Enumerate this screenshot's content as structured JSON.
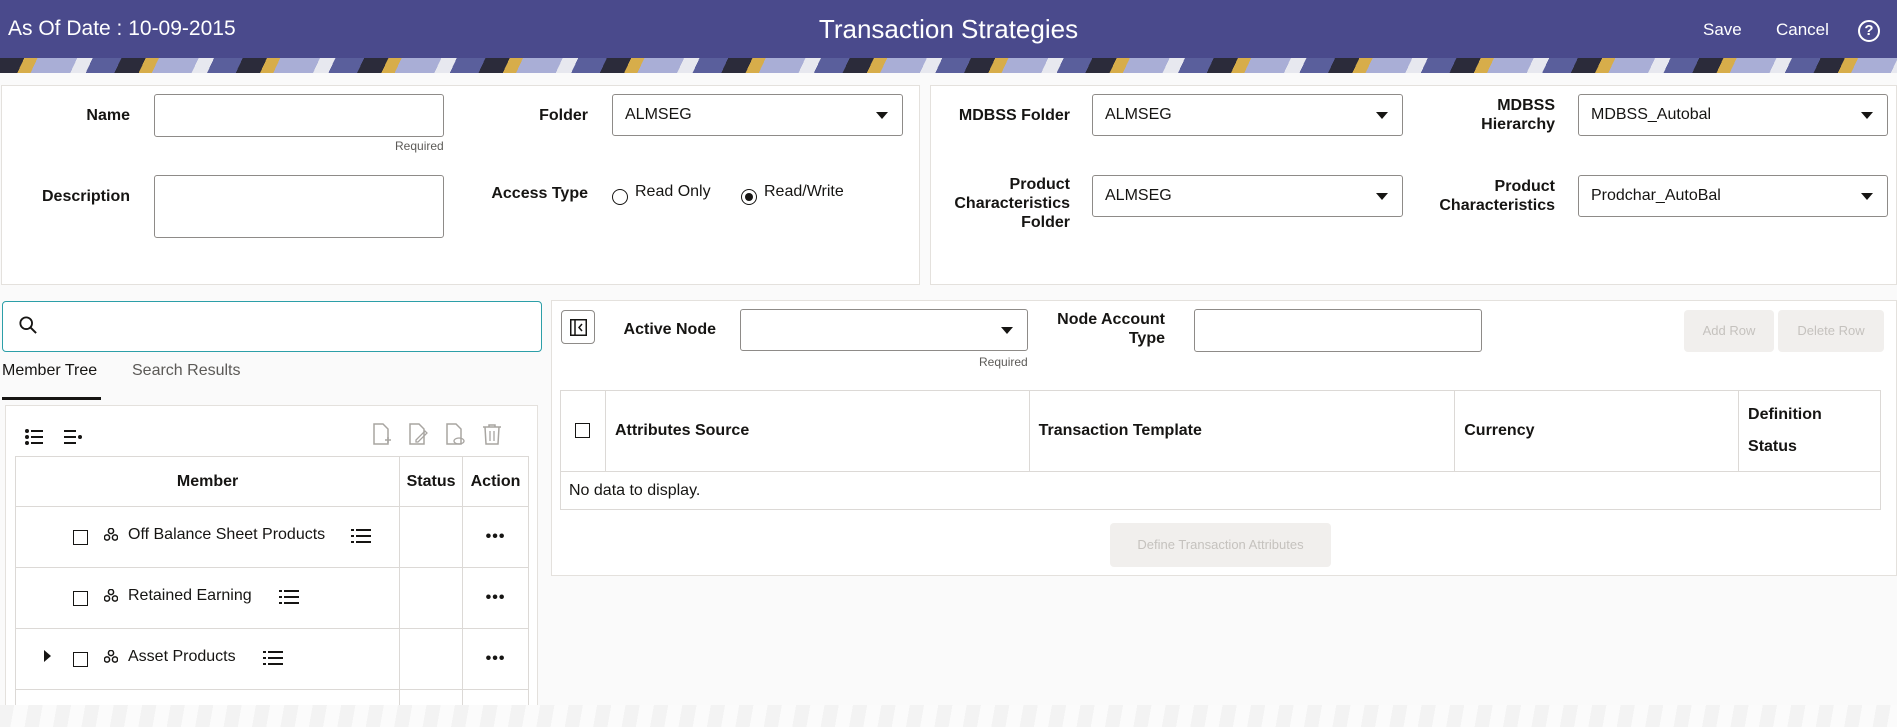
{
  "header": {
    "as_of_date": "As Of Date : 10-09-2015",
    "title": "Transaction Strategies",
    "save_label": "Save",
    "cancel_label": "Cancel",
    "help_glyph": "?"
  },
  "form": {
    "name_label": "Name",
    "name_value": "",
    "name_required": "Required",
    "description_label": "Description",
    "description_value": "",
    "folder_label": "Folder",
    "folder_value": "ALMSEG",
    "access_type_label": "Access Type",
    "access_options": [
      "Read Only",
      "Read/Write"
    ],
    "access_selected": "Read/Write",
    "mdbss_folder_label": "MDBSS Folder",
    "mdbss_folder_value": "ALMSEG",
    "mdbss_hierarchy_label_1": "MDBSS",
    "mdbss_hierarchy_label_2": "Hierarchy",
    "mdbss_hierarchy_value": "MDBSS_Autobal",
    "pc_folder_label_1": "Product",
    "pc_folder_label_2": "Characteristics",
    "pc_folder_label_3": "Folder",
    "pc_folder_value": "ALMSEG",
    "pc_label_1": "Product",
    "pc_label_2": "Characteristics",
    "pc_value": "Prodchar_AutoBal"
  },
  "tree": {
    "search_value": "",
    "tabs": [
      "Member Tree",
      "Search Results"
    ],
    "active_tab": "Member Tree",
    "columns": [
      "Member",
      "Status",
      "Action"
    ],
    "rows": [
      {
        "member": "Off Balance Sheet Products",
        "status": "",
        "action": "•••",
        "expandable": false
      },
      {
        "member": "Retained Earning",
        "status": "",
        "action": "•••",
        "expandable": false
      },
      {
        "member": "Asset Products",
        "status": "",
        "action": "•••",
        "expandable": true
      }
    ],
    "toolbar_icons": [
      "expand-all-icon",
      "collapse-all-icon",
      "add-document-icon",
      "edit-document-icon",
      "view-document-icon",
      "delete-icon"
    ]
  },
  "detail": {
    "active_node_label": "Active Node",
    "active_node_value": "",
    "active_node_required": "Required",
    "node_account_type_label_1": "Node Account",
    "node_account_type_label_2": "Type",
    "node_account_type_value": "",
    "add_row_label": "Add Row",
    "delete_row_label": "Delete Row",
    "columns": [
      "Attributes Source",
      "Transaction Template",
      "Currency",
      "Definition",
      "Status"
    ],
    "empty_message": "No data to display.",
    "define_button_label": "Define Transaction Attributes"
  },
  "colors": {
    "header_bg": "#4a4a8c",
    "search_border": "#2c9fa8"
  }
}
